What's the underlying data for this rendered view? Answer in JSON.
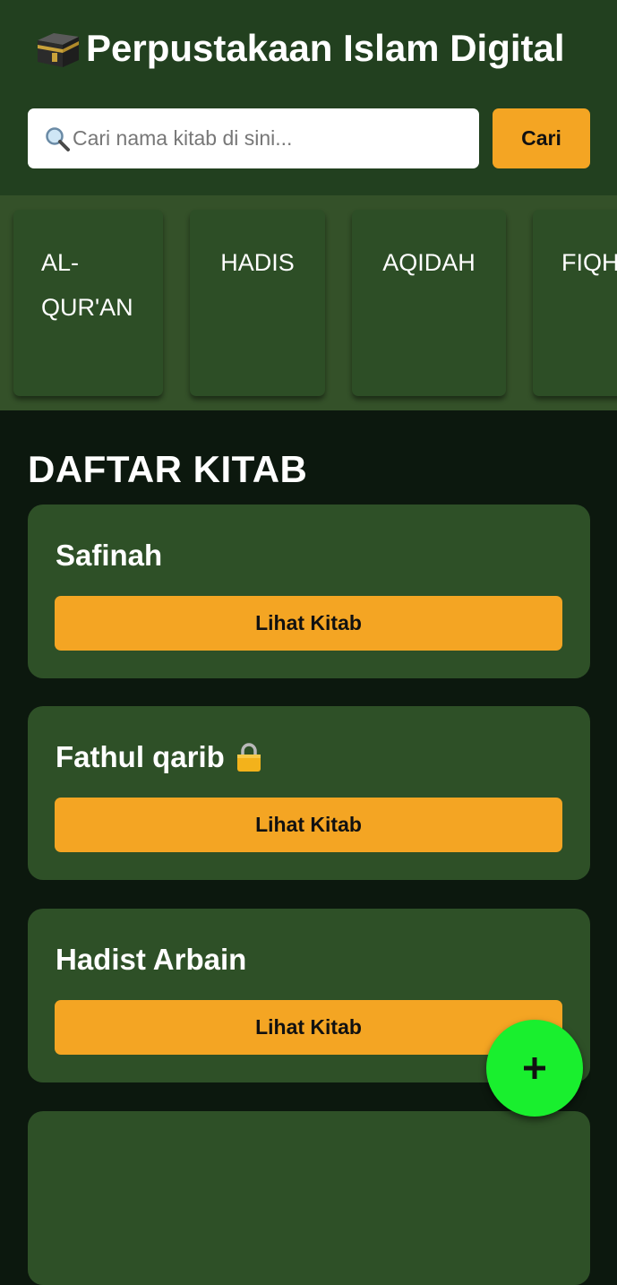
{
  "header": {
    "title": "Perpustakaan Islam Digital",
    "title_icon": "kaaba-icon"
  },
  "search": {
    "placeholder": "Cari nama kitab di sini...",
    "value": "",
    "icon": "search-icon",
    "button_label": "Cari"
  },
  "categories": [
    {
      "line1": "AL-",
      "line2": "QUR'AN"
    },
    {
      "line1": "HADIS",
      "line2": ""
    },
    {
      "line1": "AQIDAH",
      "line2": ""
    },
    {
      "line1": "FIQH",
      "line2": ""
    }
  ],
  "main": {
    "section_title": "DAFTAR KITAB",
    "books": [
      {
        "title": "Safinah",
        "locked": false,
        "button_label": "Lihat Kitab"
      },
      {
        "title": "Fathul qarib",
        "locked": true,
        "button_label": "Lihat Kitab"
      },
      {
        "title": "Hadist Arbain",
        "locked": false,
        "button_label": "Lihat Kitab"
      }
    ]
  },
  "fab": {
    "label": "+",
    "icon": "plus-icon"
  },
  "colors": {
    "header_bg": "#22401f",
    "category_strip_bg": "#345129",
    "card_bg": "#2e5027",
    "page_bg": "#0c180e",
    "accent_orange": "#f4a523",
    "fab_green": "#19ef2e"
  }
}
